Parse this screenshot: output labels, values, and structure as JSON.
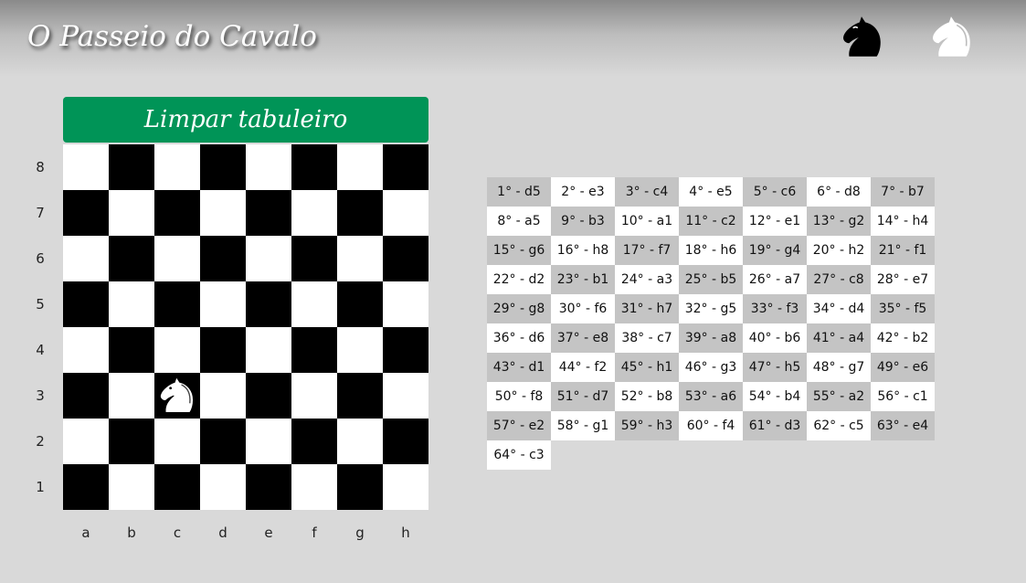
{
  "header": {
    "title": "O Passeio do Cavalo",
    "buttons": [
      {
        "id": "btn-black",
        "icon": "black-knight-icon",
        "color": "#000000"
      },
      {
        "id": "btn-white",
        "icon": "white-knight-icon",
        "color": "#ffffff"
      }
    ]
  },
  "controls": {
    "clear_label": "Limpar tabuleiro",
    "clear_color": "#009457"
  },
  "board": {
    "ranks": [
      "8",
      "7",
      "6",
      "5",
      "4",
      "3",
      "2",
      "1"
    ],
    "files": [
      "a",
      "b",
      "c",
      "d",
      "e",
      "f",
      "g",
      "h"
    ],
    "knight": {
      "square": "c3",
      "piece": "white-knight-icon"
    }
  },
  "moves": [
    "1° - d5",
    "2° - e3",
    "3° - c4",
    "4° - e5",
    "5° - c6",
    "6° - d8",
    "7° - b7",
    "8° - a5",
    "9° - b3",
    "10° - a1",
    "11° - c2",
    "12° - e1",
    "13° - g2",
    "14° - h4",
    "15° - g6",
    "16° - h8",
    "17° - f7",
    "18° - h6",
    "19° - g4",
    "20° - h2",
    "21° - f1",
    "22° - d2",
    "23° - b1",
    "24° - a3",
    "25° - b5",
    "26° - a7",
    "27° - c8",
    "28° - e7",
    "29° - g8",
    "30° - f6",
    "31° - h7",
    "32° - g5",
    "33° - f3",
    "34° - d4",
    "35° - f5",
    "36° - d6",
    "37° - e8",
    "38° - c7",
    "39° - a8",
    "40° - b6",
    "41° - a4",
    "42° - b2",
    "43° - d1",
    "44° - f2",
    "45° - h1",
    "46° - g3",
    "47° - h5",
    "48° - g7",
    "49° - e6",
    "50° - f8",
    "51° - d7",
    "52° - b8",
    "53° - a6",
    "54° - b4",
    "55° - a2",
    "56° - c1",
    "57° - e2",
    "58° - g1",
    "59° - h3",
    "60° - f4",
    "61° - d3",
    "62° - c5",
    "63° - e4",
    "64° - c3"
  ]
}
